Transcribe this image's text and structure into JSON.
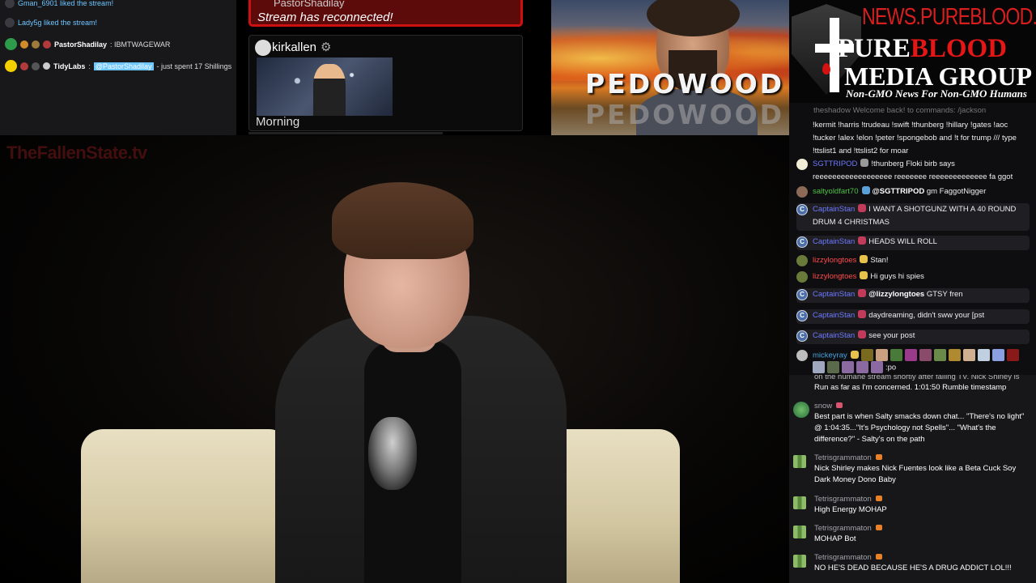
{
  "overlay": {
    "watermark": "TheFallenState.tv"
  },
  "alerts": [
    {
      "type": "like",
      "text": "Gman_6901 liked the stream!"
    },
    {
      "type": "like",
      "text": "Lady5g liked the stream!"
    },
    {
      "type": "chat",
      "user": "PastorShadilay",
      "text": ": IBMTWAGEWAR"
    },
    {
      "type": "chat",
      "user": "TidyLabs",
      "pre": ":",
      "mention": "@PastorShadilay",
      "text": "- just spent 17 Shillings"
    }
  ],
  "reconnect": {
    "cut_name": "PastorShadilay",
    "message": "Stream has reconnected!"
  },
  "card": {
    "name": "kirkallen",
    "caption": "Morning"
  },
  "top_video": {
    "title": "PEDOWOOD",
    "title_reflection": "PEDOWOOD"
  },
  "logo": {
    "domain": "NEWS.PUREBLOOD.MEDIA",
    "line1_a": "P",
    "line1_b": "URE",
    "line1_c": "BLOOD",
    "line2": "MEDIA GROUP",
    "tagline": "Non-GMO News For Non-GMO Humans"
  },
  "chat1": {
    "cutline": "theshadow Welcome back! to commands: /jackson",
    "messages": [
      {
        "user": "",
        "text": "!kermit !harris !trudeau !swift !thunberg !hillary !gates !aoc !tucker !alex !elon !peter !spongebob and !t for trump /// type !ttslist1 and !ttslist2 for moar"
      },
      {
        "user": "SGTTRIPOD",
        "color": "#6d78ff",
        "text": "!thunberg Floki birb says reeeeeeeeeeeeeeeeee reeeeeee reeeeeeeeeeeee fa ggot"
      },
      {
        "user": "saltyoldfart70",
        "color": "#4fc246",
        "mention": "@SGTTRIPOD",
        "text": " gm FaggotNigger"
      },
      {
        "user": "CaptainStan",
        "color": "#6d78ff",
        "text": "I WANT A SHOTGUNZ WITH A 40 ROUND DRUM 4 CHRISTMAS"
      },
      {
        "user": "CaptainStan",
        "color": "#6d78ff",
        "text": "HEADS WILL ROLL"
      },
      {
        "user": "lizzylongtoes",
        "color": "#ff4b4b",
        "text": "Stan!"
      },
      {
        "user": "lizzylongtoes",
        "color": "#ff4b4b",
        "text": "Hi guys hi spies"
      },
      {
        "user": "CaptainStan",
        "color": "#6d78ff",
        "mention": "@lizzylongtoes",
        "text": " GTSY fren"
      },
      {
        "user": "CaptainStan",
        "color": "#6d78ff",
        "text": "daydreaming, didn't sww your [pst"
      },
      {
        "user": "CaptainStan",
        "color": "#6d78ff",
        "text": "see your post"
      },
      {
        "user": "mickeyray",
        "color": "#47a3e0",
        "text": ":po"
      }
    ]
  },
  "chat2": {
    "cutline": "on the humane stream shortly after falling TV. Nick Shirley is",
    "messages": [
      {
        "user": "",
        "text": "Run as far as I'm concerned. 1:01:50 Rumble timestamp"
      },
      {
        "user": "snow",
        "text": "Best part is when Salty smacks down chat... \"There's no light\" @ 1:04:35...\"It's Psychology not Spells\"... \"What's the difference?\" - Salty's on the path"
      },
      {
        "user": "Tetrisgrammaton",
        "text": "Nick Shirley makes Nick Fuentes look like a Beta Cuck Soy Dark Money Dono Baby"
      },
      {
        "user": "Tetrisgrammaton",
        "text": "High Energy MOHAP"
      },
      {
        "user": "Tetrisgrammaton",
        "text": "MOHAP Bot"
      },
      {
        "user": "Tetrisgrammaton",
        "text": "NO HE'S DEAD BECAUSE HE'S A DRUG ADDICT LOL!!!"
      }
    ]
  }
}
